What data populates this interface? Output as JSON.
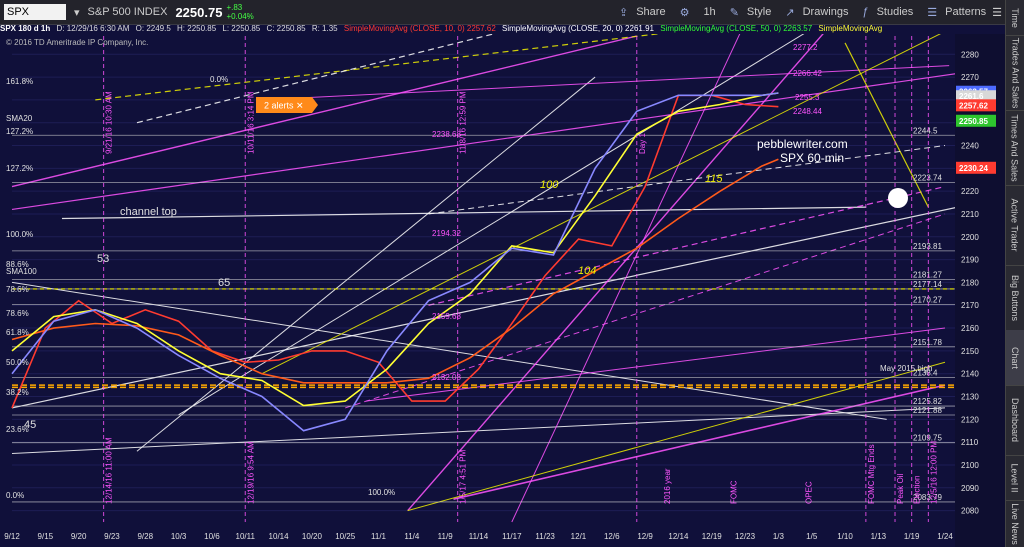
{
  "toolbar": {
    "symbol": "SPX",
    "index_name": "S&P 500 INDEX",
    "price": "2250.75",
    "change": "+.83",
    "change_pct": "+0.04%",
    "share": "Share",
    "interval": "1h",
    "style": "Style",
    "drawings": "Drawings",
    "studies": "Studies",
    "patterns": "Patterns"
  },
  "infobar": {
    "symbol_period": "SPX 180 d 1h",
    "datetime": "D: 12/29/16 6:30 AM",
    "open": "O: 2249.5",
    "high": "H: 2250.85",
    "low": "L: 2250.85",
    "close": "C: 2250.85",
    "range": "R: 1.35",
    "sma10": "SimpleMovingAvg (CLOSE, 10, 0) 2257.62",
    "sma20": "SimpleMovingAvg (CLOSE, 20, 0) 2261.91",
    "sma50": "SimpleMovingAvg (CLOSE, 50, 0) 2263.57",
    "sma_more": "SimpleMovingAvg"
  },
  "copyright": "© 2016 TD Ameritrade IP Company, Inc.",
  "alerts_label": "2 alerts ✕",
  "watermark": {
    "line1": "pebblewriter.com",
    "line2": "SPX 60-min"
  },
  "sidebar_tabs": [
    "Time",
    "Trades And Sales",
    "Times And Sales",
    "Active Trader",
    "Big Buttons",
    "Chart",
    "Dashboard",
    "Level II",
    "Live News"
  ],
  "colors": {
    "background": "#10103a",
    "sma10": "#ff3b30",
    "sma20": "#ffffff",
    "sma50": "#33ff33",
    "magenta": "#ff55ff",
    "yellow": "#f0f000",
    "orange": "#ff5a1a"
  },
  "chart_data": {
    "type": "line",
    "title": "",
    "x_tick_labels": [
      "9/12",
      "9/15",
      "9/20",
      "9/23",
      "9/28",
      "10/3",
      "10/6",
      "10/11",
      "10/14",
      "10/20",
      "10/25",
      "11/1",
      "11/4",
      "11/9",
      "11/14",
      "11/17",
      "11/23",
      "12/1",
      "12/6",
      "12/9",
      "12/14",
      "12/19",
      "12/23",
      "1/3",
      "1/5",
      "1/10",
      "1/13",
      "1/19",
      "1/24"
    ],
    "y_tick_labels": [
      2080,
      2090,
      2100,
      2110,
      2120,
      2130,
      2140,
      2150,
      2160,
      2170,
      2180,
      2190,
      2200,
      2210,
      2220,
      2230,
      2240,
      2250,
      2260,
      2270,
      2280
    ],
    "ylim": [
      2075,
      2288
    ],
    "right_price_labels": [
      {
        "value": 2263.57,
        "text": "2263.57",
        "color": "#4d6bff"
      },
      {
        "value": 2261.6,
        "text": "2261.6",
        "color": "#d8d8d8"
      },
      {
        "value": 2257.62,
        "text": "2257.62",
        "color": "#ff3b30"
      },
      {
        "value": 2250.85,
        "text": "2250.85",
        "color": "#2ec52e"
      },
      {
        "value": 2230.24,
        "text": "2230.24",
        "color": "#ff3b30"
      }
    ],
    "level_labels": [
      {
        "value": 2244.5,
        "text": "2244.5"
      },
      {
        "value": 2223.74,
        "text": "2223.74"
      },
      {
        "value": 2193.81,
        "text": "2193.81"
      },
      {
        "value": 2181.27,
        "text": "2181.27"
      },
      {
        "value": 2177.14,
        "text": "2177.14"
      },
      {
        "value": 2170.27,
        "text": "2170.27"
      },
      {
        "value": 2151.78,
        "text": "2151.78"
      },
      {
        "value": 2138.4,
        "text": "2138.4"
      },
      {
        "value": 2125.82,
        "text": "2125.82"
      },
      {
        "value": 2121.88,
        "text": "2121.88"
      },
      {
        "value": 2109.75,
        "text": "2109.75"
      },
      {
        "value": 2083.79,
        "text": "2083.79"
      }
    ],
    "chart_labels": [
      "0.0%",
      "161.8%",
      "SMA20",
      "127.2%",
      "127.2%",
      "100.0%",
      "88.6%",
      "78.6%",
      "78.6%",
      "61.8%",
      "50.0%",
      "38.2%",
      "23.6%",
      "0.0%",
      "100.0%",
      "SMA100",
      "2238.68",
      "2194.32",
      "2159.68",
      "2132.08",
      "2277.2",
      "2266.42",
      "2255.3",
      "2248.44",
      "May 2015 high",
      "channel top",
      "100",
      "104",
      "115",
      "53",
      "65",
      "45"
    ],
    "vertical_annotations": [
      "9/21/16 10:30 AM",
      "10/11/16 3:14 PM",
      "11/8/16 12:59 PM",
      "Day 1",
      "FOMC Mtg Ends",
      "Peak Oil",
      "Election",
      "12/5/16 12:00 PM",
      "12/14/16 11:00 AM",
      "12/19/16 9:54 AM",
      "1/5/17 4:51 PM",
      "2016 year",
      "FOMC",
      "OPEC"
    ],
    "series": [
      {
        "name": "",
        "color": "#ff3b30",
        "x": [
          0,
          8,
          16,
          24,
          32,
          40,
          48,
          56,
          64,
          72,
          80,
          88,
          96,
          104,
          112,
          120,
          128,
          136,
          144,
          152,
          160,
          168,
          176,
          184
        ],
        "values": [
          2125,
          2160,
          2172,
          2162,
          2168,
          2163,
          2150,
          2145,
          2146,
          2150,
          2150,
          2145,
          2128,
          2128,
          2142,
          2162,
          2183,
          2199,
          2196,
          2222,
          2262,
          2262,
          2258,
          2257
        ]
      },
      {
        "name": "",
        "color": "#ff5a1a",
        "x": [
          0,
          10,
          20,
          30,
          40,
          50,
          60,
          70,
          80,
          90,
          100,
          110,
          120,
          130,
          140,
          150,
          160,
          170,
          180,
          184
        ],
        "values": [
          2155,
          2160,
          2162,
          2161,
          2157,
          2148,
          2140,
          2136,
          2136,
          2136,
          2138,
          2147,
          2160,
          2175,
          2185,
          2195,
          2208,
          2220,
          2231,
          2234
        ]
      },
      {
        "name": "",
        "color": "#ffff33",
        "x": [
          0,
          10,
          20,
          30,
          40,
          50,
          60,
          70,
          80,
          90,
          100,
          110,
          120,
          130,
          140,
          150,
          160,
          170,
          180,
          184
        ],
        "values": [
          2150,
          2165,
          2168,
          2162,
          2150,
          2140,
          2137,
          2126,
          2128,
          2142,
          2162,
          2175,
          2196,
          2193,
          2218,
          2245,
          2255,
          2258,
          2262,
          2263
        ]
      },
      {
        "name": "",
        "color": "#8888ff",
        "x": [
          0,
          10,
          20,
          30,
          40,
          50,
          60,
          70,
          80,
          90,
          100,
          110,
          120,
          130,
          140,
          150,
          160,
          170,
          180,
          184
        ],
        "values": [
          2140,
          2163,
          2168,
          2160,
          2148,
          2138,
          2130,
          2115,
          2120,
          2150,
          2172,
          2180,
          2195,
          2192,
          2230,
          2255,
          2262,
          2262,
          2262,
          2263
        ]
      }
    ]
  }
}
